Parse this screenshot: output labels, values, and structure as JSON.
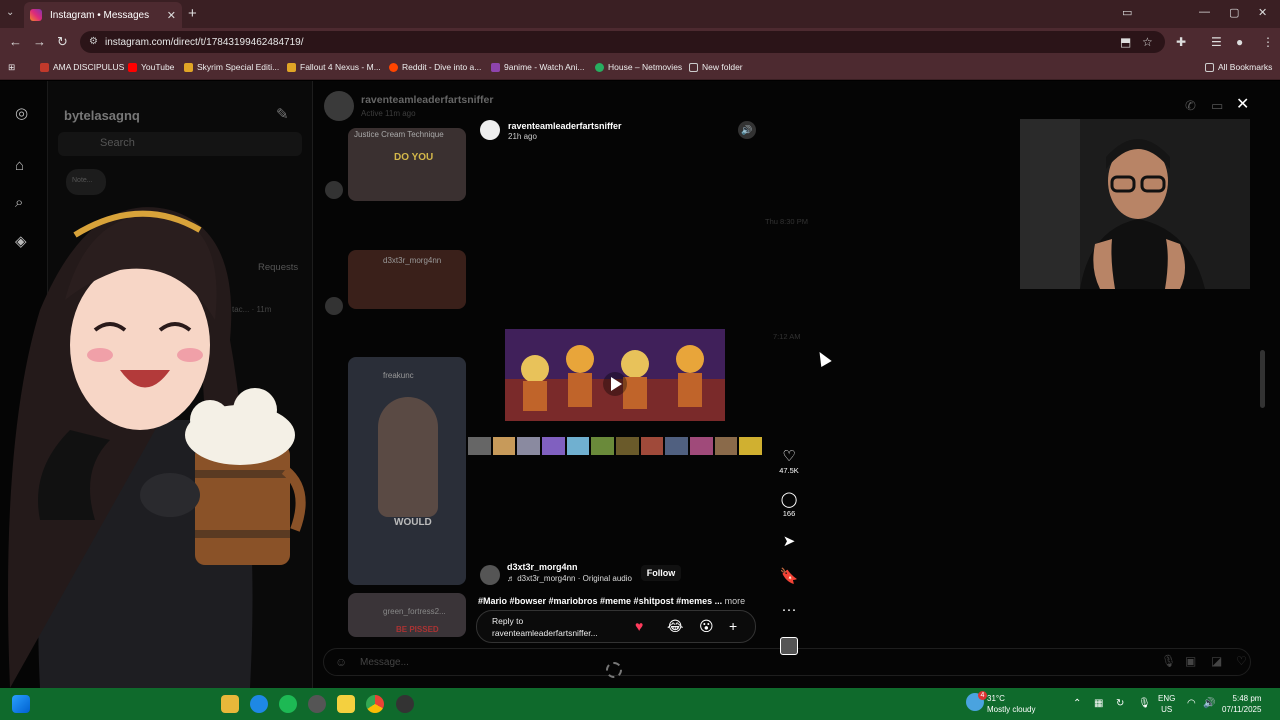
{
  "browser": {
    "tab_title": "Instagram • Messages",
    "url": "instagram.com/direct/t/17843199462484719/",
    "bookmarks": [
      {
        "label": "AMA DISCIPULUS",
        "color": "#c0392b"
      },
      {
        "label": "YouTube",
        "color": "#ff0000"
      },
      {
        "label": "Skyrim Special Editi...",
        "color": "#e0a526"
      },
      {
        "label": "Fallout 4 Nexus - M...",
        "color": "#e0a526"
      },
      {
        "label": "Reddit - Dive into a...",
        "color": "#ff4500"
      },
      {
        "label": "9anime - Watch Ani...",
        "color": "#8e44ad"
      },
      {
        "label": "House – Netmovies",
        "color": "#27ae60"
      },
      {
        "label": "New folder",
        "color": "#cccccc"
      }
    ],
    "all_bookmarks": "All Bookmarks"
  },
  "inbox": {
    "username": "bytelasagnq",
    "search_placeholder": "Search",
    "note_label": "Note...",
    "requests_label": "Requests",
    "conv_time": "tac... · 11m"
  },
  "chat": {
    "name": "raventeamleaderfartsniffer",
    "active": "Active 11m ago",
    "timestamps": [
      "Thu 8:30 PM",
      "7:12 AM"
    ],
    "shared_usernames": [
      "d3xt3r_morg4nn",
      "freakunc",
      "green_fortress2..."
    ],
    "thumb_texts": [
      "Justice Cream Technique",
      "DO YOU",
      "WOULD",
      "BE PISSED"
    ],
    "message_placeholder": "Message..."
  },
  "reel": {
    "sender": "raventeamleaderfartsniffer",
    "sent_ago": "21h ago",
    "likes": "47.5K",
    "comments": "166",
    "author": "d3xt3r_morg4nn",
    "audio": "♬ d3xt3r_morg4nn · Original audio",
    "follow_label": "Follow",
    "caption": "#Mario #bowser #mariobros #meme #shitpost #memes ...",
    "more_label": "more",
    "reply_line1": "Reply to",
    "reply_line2": "raventeamleaderfartsniffer...",
    "reactions": [
      "♥",
      "😂",
      "😮",
      "+"
    ]
  },
  "taskbar": {
    "temperature": "31°C",
    "weather": "Mostly cloudy",
    "lang1": "ENG",
    "lang2": "US",
    "time": "5:48 pm",
    "date": "07/11/2025",
    "weather_badge": "4"
  }
}
